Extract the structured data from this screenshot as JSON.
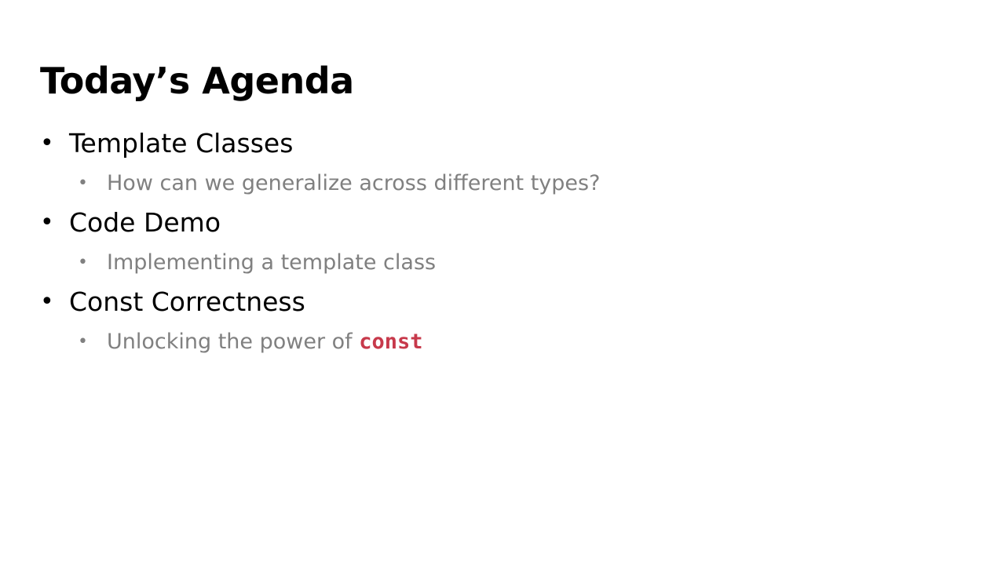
{
  "slide": {
    "title": "Today’s Agenda",
    "bullet_glyph": "•",
    "items": [
      {
        "label": "Template Classes",
        "sub": "How can we generalize across different types?"
      },
      {
        "label": "Code Demo",
        "sub": "Implementing a template class"
      },
      {
        "label": "Const Correctness",
        "sub_prefix": "Unlocking the power of ",
        "sub_code": "const"
      }
    ]
  },
  "colors": {
    "title": "#000000",
    "item_text": "#000000",
    "sub_text": "#808080",
    "code_keyword": "#c7394b",
    "background": "#ffffff"
  }
}
